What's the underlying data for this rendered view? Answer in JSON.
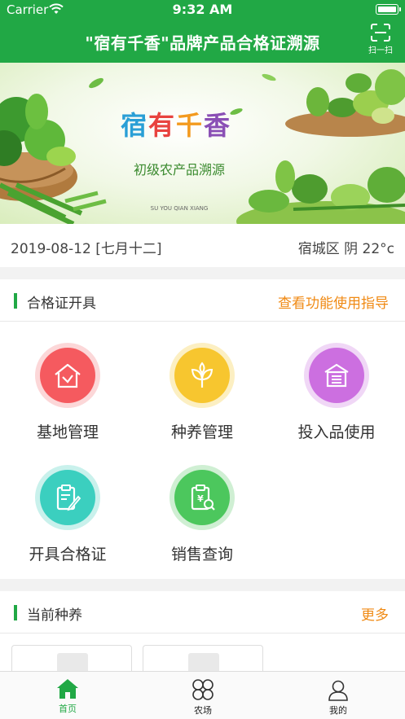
{
  "status_bar": {
    "carrier": "Carrier",
    "time": "9:32 AM"
  },
  "nav": {
    "title": "\"宿有千香\"品牌产品合格证溯源",
    "scan_label": "扫一扫"
  },
  "banner": {
    "logo_cn": "宿有千香",
    "logo_en": "SU YOU QIAN XIANG",
    "subtitle": "初级农产品溯源"
  },
  "info": {
    "date": "2019-08-12 [七月十二]",
    "weather": "宿城区 阴 22°c"
  },
  "certificate_section": {
    "title": "合格证开具",
    "link": "查看功能使用指导",
    "items": [
      {
        "label": "基地管理",
        "icon": "house-icon",
        "color": "#f55a5f",
        "ring": "#fcd7d8"
      },
      {
        "label": "种养管理",
        "icon": "sprout-icon",
        "color": "#f7c62f",
        "ring": "#fcefc2"
      },
      {
        "label": "投入品使用",
        "icon": "store-icon",
        "color": "#cc6fe0",
        "ring": "#f0d7f6"
      },
      {
        "label": "开具合格证",
        "icon": "certificate-edit-icon",
        "color": "#3bcfbf",
        "ring": "#c9f1ec"
      },
      {
        "label": "销售查询",
        "icon": "sales-search-icon",
        "color": "#4cc75d",
        "ring": "#cfefd3"
      }
    ]
  },
  "current_section": {
    "title": "当前种养",
    "link": "更多"
  },
  "tabbar": {
    "tabs": [
      {
        "label": "首页",
        "icon": "home-icon",
        "active": true
      },
      {
        "label": "农场",
        "icon": "farm-icon",
        "active": false
      },
      {
        "label": "我的",
        "icon": "profile-icon",
        "active": false
      }
    ]
  },
  "colors": {
    "primary": "#21a845",
    "accent": "#f08a14"
  }
}
